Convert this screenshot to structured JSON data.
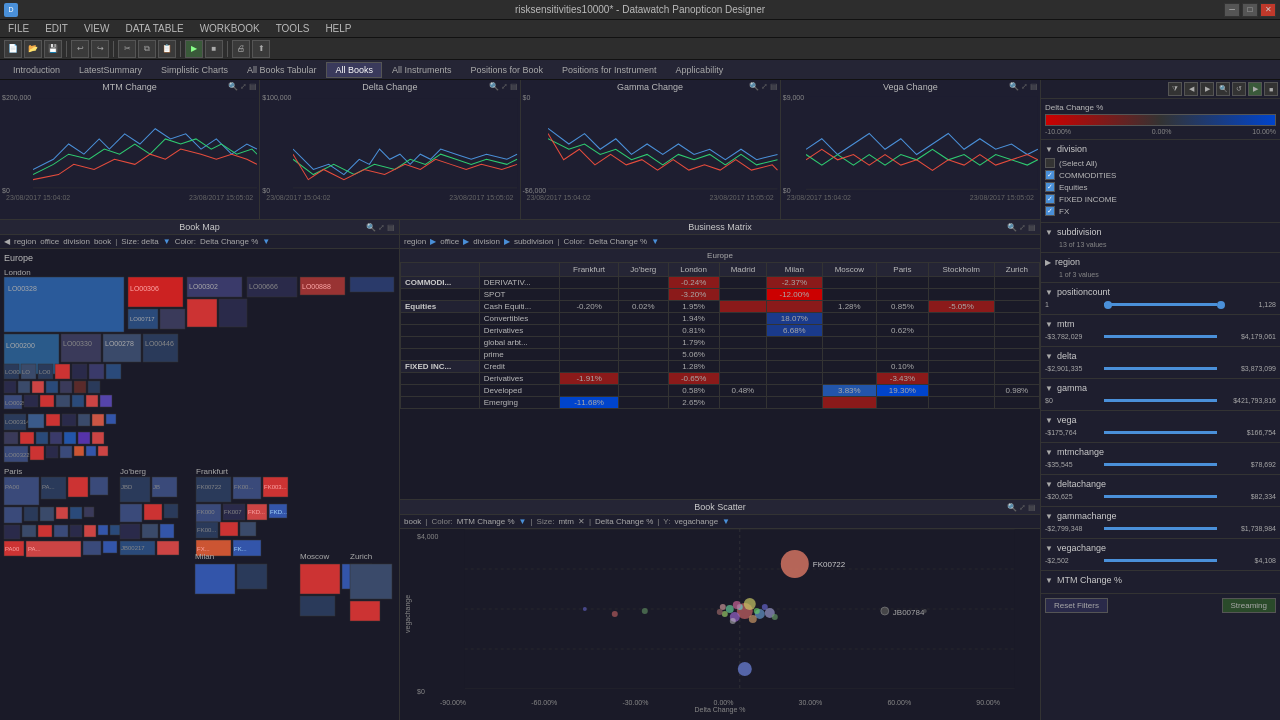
{
  "window": {
    "title": "risksensitivities10000* - Datawatch Panopticon Designer",
    "app_icon": "D"
  },
  "menubar": {
    "items": [
      "FILE",
      "EDIT",
      "VIEW",
      "DATA TABLE",
      "WORKBOOK",
      "TOOLS",
      "HELP"
    ]
  },
  "tabs": {
    "items": [
      "Introduction",
      "LatestSummary",
      "Simplistic Charts",
      "All Books Tabular",
      "All Books",
      "All Instruments",
      "Positions for Book",
      "Positions for Instrument",
      "Applicability"
    ]
  },
  "charts": {
    "mtm": {
      "title": "MTM Change",
      "y_labels": [
        "$200,000",
        "$0"
      ],
      "dates": [
        "23/08/2017 15:04:02",
        "23/08/2017 15:05:02"
      ]
    },
    "delta": {
      "title": "Delta Change",
      "y_labels": [
        "$100,000",
        "$0"
      ],
      "dates": [
        "23/08/2017 15:04:02",
        "23/08/2017 15:05:02"
      ]
    },
    "gamma": {
      "title": "Gamma Change",
      "y_labels": [
        "$0",
        "-$6,000"
      ],
      "dates": [
        "23/08/2017 15:04:02",
        "23/08/2017 15:05:02"
      ]
    },
    "vega": {
      "title": "Vega Change",
      "y_labels": [
        "$9,000",
        "$0"
      ],
      "dates": [
        "23/08/2017 15:04:02",
        "23/08/2017 15:05:02"
      ]
    }
  },
  "book_map": {
    "title": "Book Map",
    "filters": [
      "region",
      "office",
      "division",
      "book",
      "Size: delta",
      "Color: Delta Change %"
    ]
  },
  "business_matrix": {
    "title": "Business Matrix",
    "filters": [
      "region",
      "office",
      "division",
      "subdivision",
      "Color: Delta Change %"
    ],
    "europe_label": "Europe",
    "columns": [
      "",
      "",
      "Frankfurt",
      "Jo'berg",
      "London",
      "Madrid",
      "Milan",
      "Moscow",
      "Paris",
      "Stockholm",
      "Zurich"
    ],
    "rows": [
      {
        "section": "COMMODI...",
        "sub": "DERIVATIV...",
        "frankfurt": "",
        "joberg": "",
        "london": "-0.24%",
        "madrid": "",
        "milan": "-2.37%",
        "moscow": "",
        "paris": "",
        "stockholm": "",
        "zurich": "",
        "london_cls": "cell-red",
        "milan_cls": "cell-red"
      },
      {
        "section": "",
        "sub": "SPOT",
        "frankfurt": "",
        "joberg": "",
        "london": "-3.20%",
        "madrid": "",
        "milan": "-12.00%",
        "moscow": "",
        "paris": "",
        "stockholm": "",
        "zurich": "",
        "london_cls": "cell-red",
        "milan_cls": "cell-red-strong"
      },
      {
        "section": "Equities",
        "sub": "Cash Equiti...",
        "frankfurt": "-0.20%",
        "joberg": "0.02%",
        "london": "1.95%",
        "madrid": "",
        "milan": "",
        "moscow": "1.28%",
        "paris": "0.85%",
        "stockholm": "-5.05%",
        "zurich": "",
        "stockholm_cls": "cell-red"
      },
      {
        "section": "",
        "sub": "Convertibles",
        "frankfurt": "",
        "joberg": "",
        "london": "1.94%",
        "madrid": "",
        "milan": "18.07%",
        "moscow": "",
        "paris": "",
        "stockholm": "",
        "zurich": "",
        "milan_cls": "cell-blue"
      },
      {
        "section": "",
        "sub": "Derivatives",
        "frankfurt": "",
        "joberg": "",
        "london": "0.81%",
        "madrid": "",
        "milan": "6.68%",
        "moscow": "",
        "paris": "0.62%",
        "stockholm": "",
        "zurich": "",
        "milan_cls": "cell-blue"
      },
      {
        "section": "",
        "sub": "global arbt...",
        "frankfurt": "",
        "joberg": "",
        "london": "1.79%",
        "madrid": "",
        "milan": "",
        "moscow": "",
        "paris": "",
        "stockholm": "",
        "zurich": ""
      },
      {
        "section": "",
        "sub": "prime",
        "frankfurt": "",
        "joberg": "",
        "london": "5.06%",
        "madrid": "",
        "milan": "",
        "moscow": "",
        "paris": "",
        "stockholm": "",
        "zurich": ""
      },
      {
        "section": "FIXED INC...",
        "sub": "Credit",
        "frankfurt": "",
        "joberg": "",
        "london": "1.28%",
        "madrid": "",
        "milan": "",
        "moscow": "",
        "paris": "0.10%",
        "stockholm": "",
        "zurich": ""
      },
      {
        "section": "",
        "sub": "Derivatives",
        "frankfurt": "-1.91%",
        "joberg": "",
        "london": "-0.65%",
        "madrid": "",
        "milan": "",
        "moscow": "",
        "paris": "-3.43%",
        "stockholm": "",
        "zurich": "",
        "frankfurt_cls": "cell-red",
        "london_cls": "cell-red",
        "paris_cls": "cell-red"
      },
      {
        "section": "",
        "sub": "Developed",
        "frankfurt": "",
        "joberg": "",
        "london": "0.58%",
        "madrid": "0.48%",
        "milan": "",
        "moscow": "3.83%",
        "paris": "19.30%",
        "stockholm": "",
        "zurich": "0.98%",
        "moscow_cls": "cell-blue",
        "paris_cls": "cell-blue-strong"
      },
      {
        "section": "",
        "sub": "Emerging",
        "frankfurt": "-11.68%",
        "joberg": "",
        "london": "2.65%",
        "madrid": "",
        "milan": "",
        "moscow": "",
        "paris": "",
        "stockholm": "",
        "zurich": "",
        "frankfurt_cls": "cell-blue-strong"
      }
    ]
  },
  "book_scatter": {
    "title": "Book Scatter",
    "filters": [
      "book",
      "Color: MTM Change %",
      "Size: mtm",
      "Delta Change %",
      "Y: vegachange"
    ],
    "x_label": "Delta Change %",
    "y_label": "vegachange",
    "x_ticks": [
      "-90.00%",
      "-60.00%",
      "-30.00%",
      "0.00%",
      "30.00%",
      "60.00%",
      "90.00%"
    ],
    "y_ticks": [
      "$4,000",
      "$0"
    ],
    "annotations": [
      "FK00722",
      "JB00784"
    ],
    "y_axis_label": "vegachange"
  },
  "sidebar": {
    "toolbar_icons": [
      "filter",
      "prev",
      "next",
      "search",
      "reset",
      "play",
      "stop"
    ],
    "delta_change": {
      "label": "Delta Change %",
      "gradient_left": "#cc0000",
      "gradient_right": "#0044cc",
      "left_label": "-10.00%",
      "center_label": "0.00%",
      "right_label": "10.00%"
    },
    "division": {
      "title": "division",
      "items": [
        {
          "label": "(Select All)",
          "checked": false
        },
        {
          "label": "COMMODITIES",
          "checked": true
        },
        {
          "label": "Equities",
          "checked": true
        },
        {
          "label": "FIXED INCOME",
          "checked": true
        },
        {
          "label": "FX",
          "checked": true
        }
      ]
    },
    "subdivision": {
      "title": "subdivision",
      "count_label": "13 of 13 values"
    },
    "region": {
      "title": "region",
      "count_label": "1 of 3 values"
    },
    "positioncount": {
      "title": "positioncount",
      "min": "1",
      "max": "1,128",
      "min_pos": "0%",
      "max_pos": "100%"
    },
    "mtm": {
      "title": "mtm",
      "min": "-$3,782,029",
      "max": "$4,179,061"
    },
    "delta": {
      "title": "delta",
      "min": "-$2,901,335",
      "max": "$3,873,099"
    },
    "gamma": {
      "title": "gamma",
      "min": "$0",
      "max": "$421,793,816"
    },
    "vega": {
      "title": "vega",
      "min": "-$175,764",
      "max": "$166,754"
    },
    "mtmchange": {
      "title": "mtmchange",
      "min": "-$35,545",
      "max": "$78,692"
    },
    "deltachange": {
      "title": "deltachange",
      "min": "-$20,625",
      "max": "$82,334"
    },
    "gammachange": {
      "title": "gammachange",
      "min": "-$2,799,348",
      "max": "$1,738,984"
    },
    "vegachange": {
      "title": "vegachange",
      "min": "-$2,502",
      "max": "$4,108"
    },
    "mtm_pct": {
      "title": "MTM Change %"
    },
    "buttons": {
      "reset": "Reset Filters",
      "streaming": "Streaming"
    }
  }
}
